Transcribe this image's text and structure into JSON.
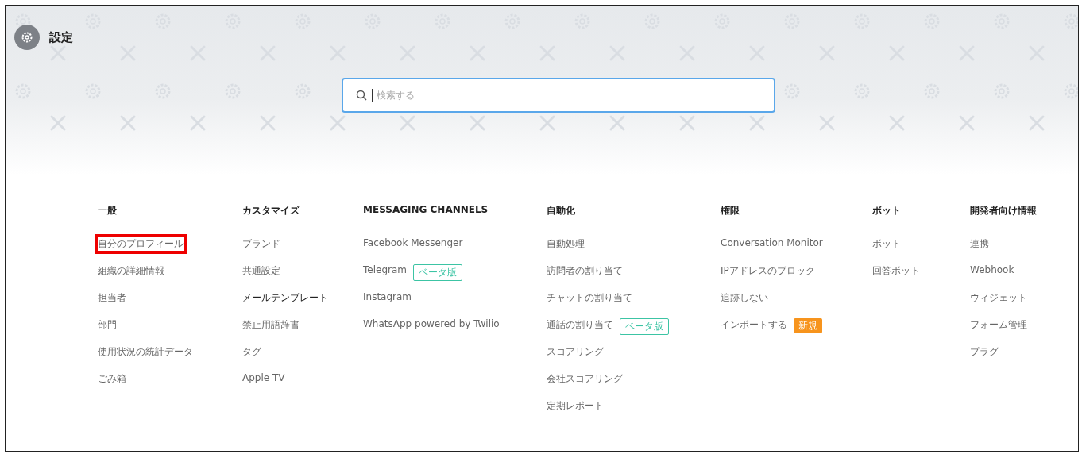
{
  "header": {
    "title": "設定"
  },
  "search": {
    "placeholder": "検索する"
  },
  "columns": [
    {
      "heading": "一般",
      "items": [
        {
          "label": "自分のプロフィール",
          "highlighted": true,
          "emphasized": false
        },
        {
          "label": "組織の詳細情報",
          "highlighted": false,
          "emphasized": false
        },
        {
          "label": "担当者",
          "highlighted": false,
          "emphasized": false
        },
        {
          "label": "部門",
          "highlighted": false,
          "emphasized": false
        },
        {
          "label": "使用状況の統計データ",
          "highlighted": false,
          "emphasized": false
        },
        {
          "label": "ごみ箱",
          "highlighted": false,
          "emphasized": false
        }
      ]
    },
    {
      "heading": "カスタマイズ",
      "items": [
        {
          "label": "ブランド",
          "highlighted": false,
          "emphasized": false
        },
        {
          "label": "共通設定",
          "highlighted": false,
          "emphasized": false
        },
        {
          "label": "メールテンプレート",
          "highlighted": false,
          "emphasized": true
        },
        {
          "label": "禁止用語辞書",
          "highlighted": false,
          "emphasized": false
        },
        {
          "label": "タグ",
          "highlighted": false,
          "emphasized": false
        },
        {
          "label": "Apple TV",
          "highlighted": false,
          "emphasized": false
        }
      ]
    },
    {
      "heading": "MESSAGING CHANNELS",
      "items": [
        {
          "label": "Facebook Messenger",
          "highlighted": false,
          "emphasized": false
        },
        {
          "label": "Telegram",
          "highlighted": false,
          "emphasized": false,
          "badge": {
            "kind": "beta",
            "text": "ベータ版"
          }
        },
        {
          "label": "Instagram",
          "highlighted": false,
          "emphasized": false
        },
        {
          "label": "WhatsApp powered by Twilio",
          "highlighted": false,
          "emphasized": false
        }
      ]
    },
    {
      "heading": "自動化",
      "items": [
        {
          "label": "自動処理",
          "highlighted": false,
          "emphasized": false
        },
        {
          "label": "訪問者の割り当て",
          "highlighted": false,
          "emphasized": false
        },
        {
          "label": "チャットの割り当て",
          "highlighted": false,
          "emphasized": false
        },
        {
          "label": "通話の割り当て",
          "highlighted": false,
          "emphasized": false,
          "badge": {
            "kind": "beta",
            "text": "ベータ版"
          }
        },
        {
          "label": "スコアリング",
          "highlighted": false,
          "emphasized": false
        },
        {
          "label": "会社スコアリング",
          "highlighted": false,
          "emphasized": false
        },
        {
          "label": "定期レポート",
          "highlighted": false,
          "emphasized": false
        }
      ]
    },
    {
      "heading": "権限",
      "items": [
        {
          "label": "Conversation Monitor",
          "highlighted": false,
          "emphasized": false
        },
        {
          "label": "IPアドレスのブロック",
          "highlighted": false,
          "emphasized": false
        },
        {
          "label": "追跡しない",
          "highlighted": false,
          "emphasized": false
        },
        {
          "label": "インポートする",
          "highlighted": false,
          "emphasized": false,
          "badge": {
            "kind": "new",
            "text": "新規"
          }
        }
      ]
    },
    {
      "heading": "ボット",
      "items": [
        {
          "label": "ボット",
          "highlighted": false,
          "emphasized": false
        },
        {
          "label": "回答ボット",
          "highlighted": false,
          "emphasized": false
        }
      ]
    },
    {
      "heading": "開発者向け情報",
      "items": [
        {
          "label": "連携",
          "highlighted": false,
          "emphasized": false
        },
        {
          "label": "Webhook",
          "highlighted": false,
          "emphasized": false
        },
        {
          "label": "ウィジェット",
          "highlighted": false,
          "emphasized": false
        },
        {
          "label": "フォーム管理",
          "highlighted": false,
          "emphasized": false
        },
        {
          "label": "プラグ",
          "highlighted": false,
          "emphasized": false
        }
      ]
    }
  ]
}
